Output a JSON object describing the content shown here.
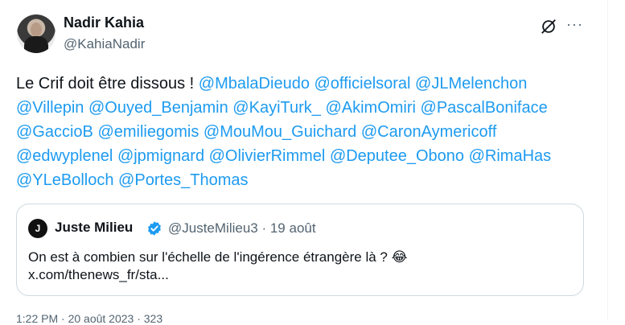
{
  "author": {
    "name": "Nadir Kahia",
    "handle": "@KahiaNadir"
  },
  "icons": {
    "grok": "grok-icon",
    "more": "more-icon"
  },
  "more_glyph": "···",
  "tweet": {
    "intro": "Le Crif doit être dissous !",
    "mentions": [
      "@MbalaDieudo",
      "@officielsoral",
      "@JLMelenchon",
      "@Villepin",
      "@Ouyed_Benjamin",
      "@KayiTurk_",
      "@AkimOmiri",
      "@PascalBoniface",
      "@GaccioB",
      "@emiliegomis",
      "@MouMou_Guichard",
      "@CaronAymericoff",
      "@edwyplenel",
      "@jpmignard",
      "@OlivierRimmel",
      "@Deputee_Obono",
      "@RimaHas",
      "@YLeBolloch",
      "@Portes_Thomas"
    ]
  },
  "quote": {
    "avatar_letter": "J",
    "name": "Juste Milieu",
    "handle_date": "@JusteMilieu3 · 19 août",
    "text": "On est à combien sur l'échelle de l'ingérence étrangère là ? 😂",
    "link": "x.com/thenews_fr/sta..."
  },
  "footer": "1:22 PM · 20 août 2023 · 323"
}
